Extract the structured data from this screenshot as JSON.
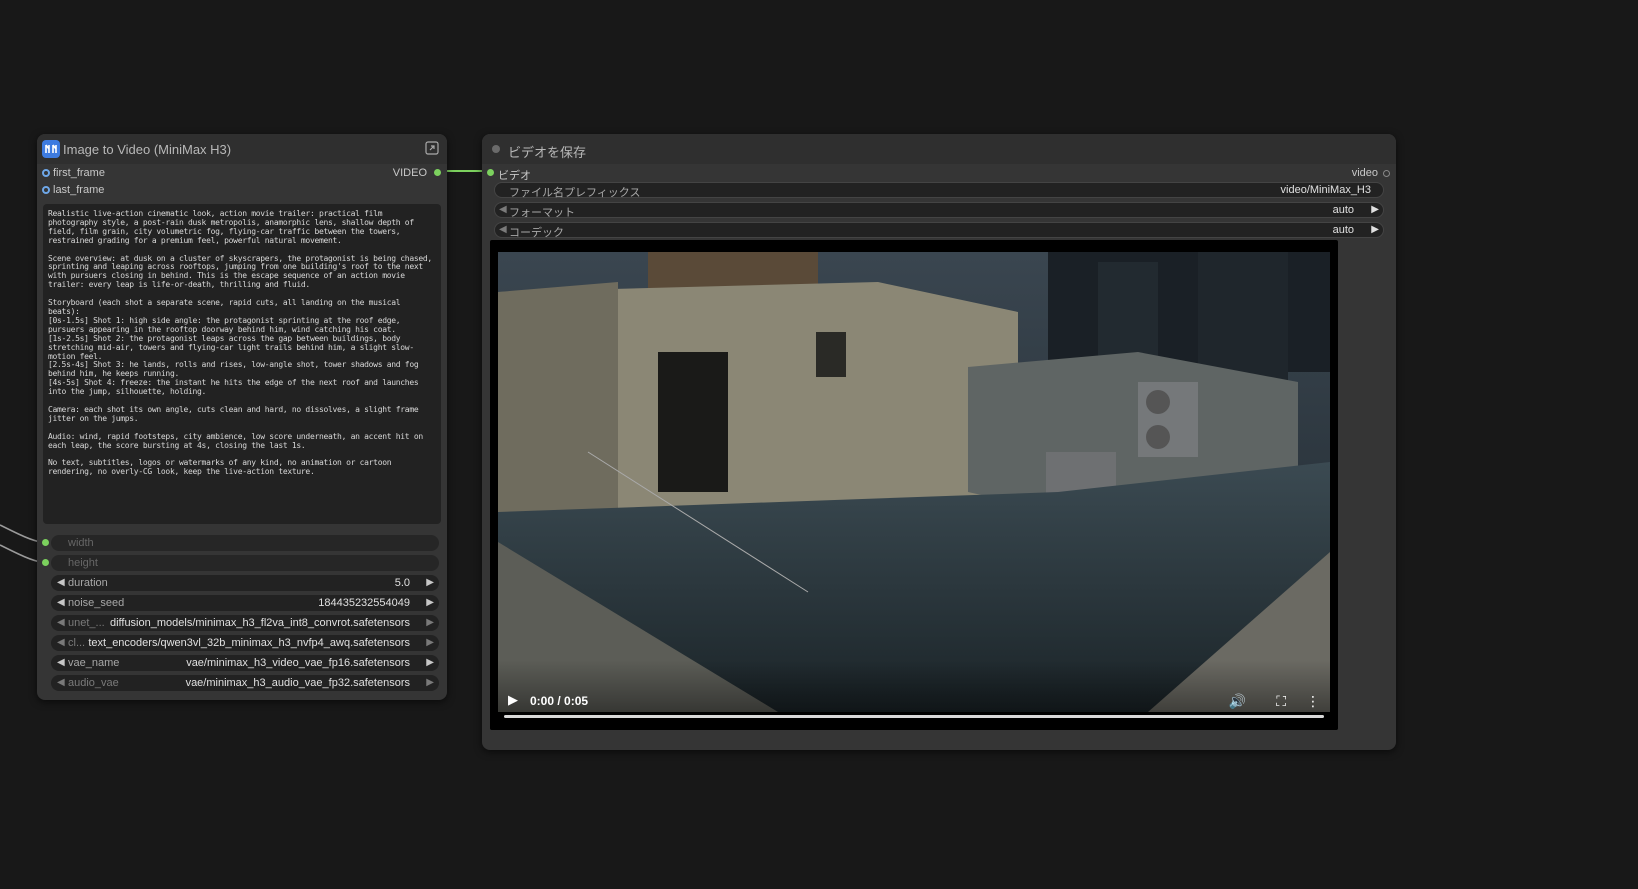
{
  "left_node": {
    "title": "Image to Video (MiniMax H3)",
    "inputs": [
      "first_frame",
      "last_frame"
    ],
    "output": "VIDEO",
    "prompt": "Realistic live-action cinematic look, action movie trailer: practical film photography style, a post-rain dusk metropolis, anamorphic lens, shallow depth of field, film grain, city volumetric fog, flying-car traffic between the towers, restrained grading for a premium feel, powerful natural movement.\n\nScene overview: at dusk on a cluster of skyscrapers, the protagonist is being chased, sprinting and leaping across rooftops, jumping from one building's roof to the next with pursuers closing in behind. This is the escape sequence of an action movie trailer: every leap is life-or-death, thrilling and fluid.\n\nStoryboard (each shot a separate scene, rapid cuts, all landing on the musical beats):\n[0s-1.5s] Shot 1: high side angle: the protagonist sprinting at the roof edge, pursuers appearing in the rooftop doorway behind him, wind catching his coat.\n[1s-2.5s] Shot 2: the protagonist leaps across the gap between buildings, body stretching mid-air, towers and flying-car light trails behind him, a slight slow-motion feel.\n[2.5s-4s] Shot 3: he lands, rolls and rises, low-angle shot, tower shadows and fog behind him, he keeps running.\n[4s-5s] Shot 4: freeze: the instant he hits the edge of the next roof and launches into the jump, silhouette, holding.\n\nCamera: each shot its own angle, cuts clean and hard, no dissolves, a slight frame jitter on the jumps.\n\nAudio: wind, rapid footsteps, city ambience, low score underneath, an accent hit on each leap, the score bursting at 4s, closing the last 1s.\n\nNo text, subtitles, logos or watermarks of any kind, no animation or cartoon rendering, no overly-CG look, keep the live-action texture.",
    "width_label": "width",
    "height_label": "height",
    "widgets": [
      {
        "name": "duration",
        "value": "5.0"
      },
      {
        "name": "noise_seed",
        "value": "184435232554049"
      },
      {
        "name": "unet_...",
        "value": "diffusion_models/minimax_h3_fl2va_int8_convrot.safetensors"
      },
      {
        "name": "cl...",
        "value": "text_encoders/qwen3vl_32b_minimax_h3_nvfp4_awq.safetensors"
      },
      {
        "name": "vae_name",
        "value": "vae/minimax_h3_video_vae_fp16.safetensors"
      },
      {
        "name": "audio_vae",
        "value": "vae/minimax_h3_audio_vae_fp32.safetensors"
      }
    ]
  },
  "right_node": {
    "title": "ビデオを保存",
    "input": "ビデオ",
    "output": "video",
    "fields": [
      {
        "name": "ファイル名プレフィックス",
        "value": "video/MiniMax_H3"
      },
      {
        "name": "フォーマット",
        "value": "auto"
      },
      {
        "name": "コーデック",
        "value": "auto"
      }
    ],
    "player": {
      "time": "0:00 / 0:05",
      "progress": 0.0
    }
  },
  "colors": {
    "canvas": "#181818",
    "node": "#353535",
    "link_green": "#7cd15e",
    "slot_blue": "#6ea7e8"
  }
}
